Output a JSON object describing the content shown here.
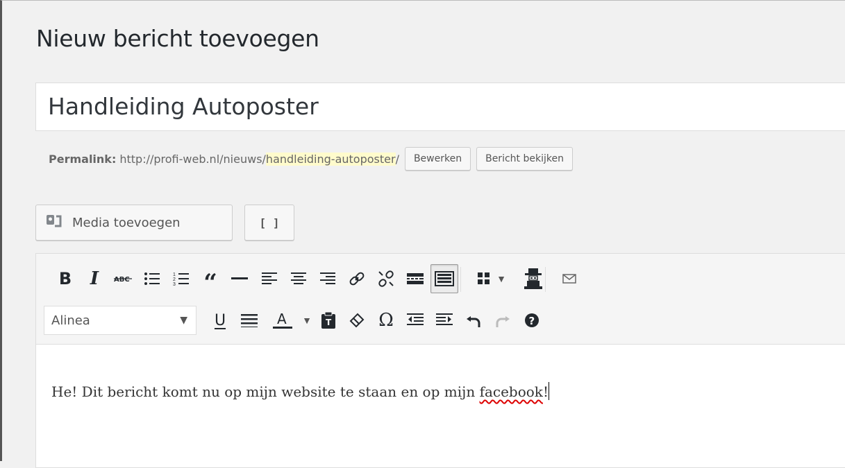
{
  "page": {
    "title": "Nieuw bericht toevoegen"
  },
  "post": {
    "title_value": "Handleiding Autoposter",
    "permalink": {
      "label": "Permalink:",
      "base": "http://profi-web.nl/nieuws/",
      "slug": "handleiding-autoposter",
      "trailing": "/",
      "edit_label": "Bewerken",
      "view_label": "Bericht bekijken"
    }
  },
  "media": {
    "add_label": "Media toevoegen",
    "shortcode_label": "[ ]"
  },
  "toolbar": {
    "row1": [
      {
        "name": "bold",
        "glyph": "B"
      },
      {
        "name": "italic",
        "glyph": "I"
      },
      {
        "name": "strikethrough",
        "glyph": "ABC"
      },
      {
        "name": "bullet-list",
        "glyph": "☰"
      },
      {
        "name": "numbered-list",
        "glyph": "☷"
      },
      {
        "name": "blockquote",
        "glyph": "❝"
      },
      {
        "name": "horizontal-line",
        "glyph": "—"
      },
      {
        "name": "align-left",
        "glyph": "≡"
      },
      {
        "name": "align-center",
        "glyph": "≡"
      },
      {
        "name": "align-right",
        "glyph": "≡"
      },
      {
        "name": "insert-link",
        "glyph": "🔗"
      },
      {
        "name": "remove-link",
        "glyph": "✂"
      },
      {
        "name": "read-more",
        "glyph": "▭"
      },
      {
        "name": "toolbar-toggle",
        "glyph": "▦"
      },
      {
        "name": "grid",
        "glyph": "▪"
      },
      {
        "name": "dropdown-caret",
        "glyph": "▾"
      },
      {
        "name": "spy-figure",
        "glyph": "♜"
      },
      {
        "name": "envelope",
        "glyph": "✉"
      }
    ],
    "row2": {
      "format_select": "Alinea",
      "buttons": [
        {
          "name": "underline",
          "glyph": "U"
        },
        {
          "name": "justify",
          "glyph": "☰"
        },
        {
          "name": "text-color",
          "glyph": "A"
        },
        {
          "name": "text-color-caret",
          "glyph": "▾"
        },
        {
          "name": "paste-as-text",
          "glyph": "📋"
        },
        {
          "name": "clear-formatting",
          "glyph": "⌫"
        },
        {
          "name": "special-character",
          "glyph": "Ω"
        },
        {
          "name": "outdent",
          "glyph": "⇤"
        },
        {
          "name": "indent",
          "glyph": "⇥"
        },
        {
          "name": "undo",
          "glyph": "↶"
        },
        {
          "name": "redo",
          "glyph": "↷"
        },
        {
          "name": "help",
          "glyph": "?"
        }
      ]
    }
  },
  "content": {
    "text_before": "He! Dit bericht komt nu op mijn website te staan en op mijn ",
    "misspelled_word": "facebook",
    "text_after": "!"
  }
}
